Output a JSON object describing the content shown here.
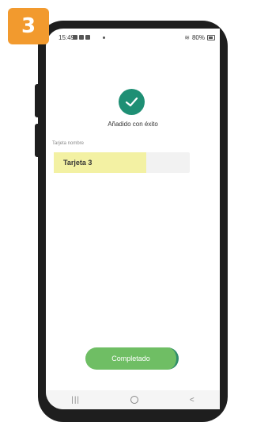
{
  "step_badge": "3",
  "status_bar": {
    "time": "15:49",
    "battery": "80%"
  },
  "main": {
    "success_message": "Añadido con éxito",
    "field_label": "Tarjeta nombre",
    "field_value": "Tarjeta 3",
    "complete_label": "Completado"
  },
  "nav_bar": {
    "recent_icon": "|||",
    "back_icon": "<"
  },
  "colors": {
    "badge": "#f29a2e",
    "success": "#1e8f74",
    "button": "#6fbe64",
    "highlight": "#f3f1a3"
  }
}
